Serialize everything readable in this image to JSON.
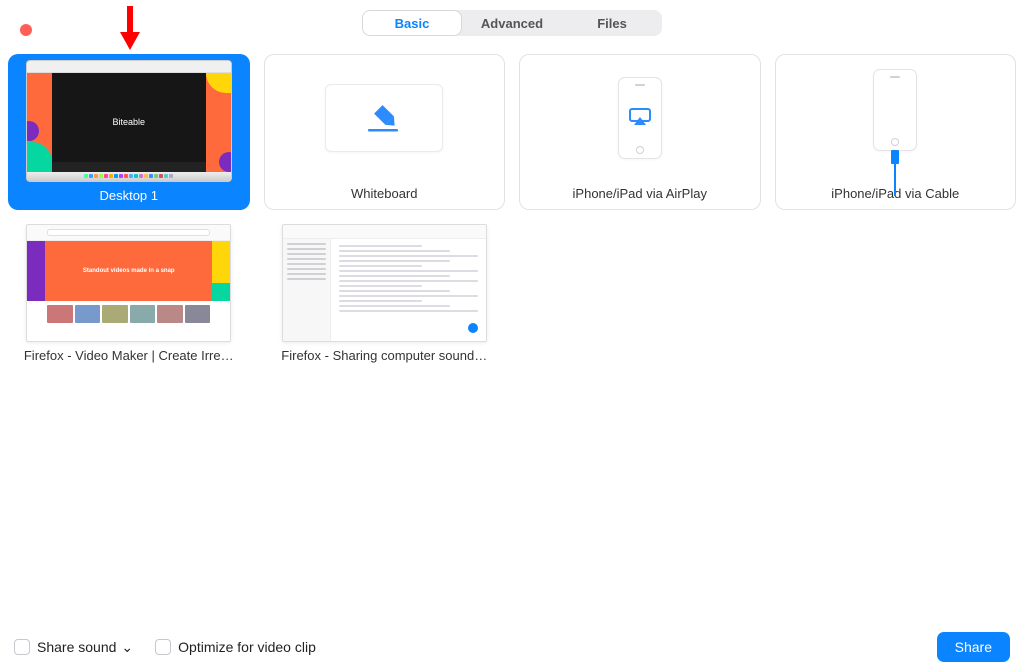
{
  "tabs": {
    "basic": "Basic",
    "advanced": "Advanced",
    "files": "Files"
  },
  "tiles": {
    "desktop1": {
      "label": "Desktop 1",
      "player_brand": "Biteable"
    },
    "whiteboard": {
      "label": "Whiteboard"
    },
    "airplay": {
      "label": "iPhone/iPad via AirPlay"
    },
    "cable": {
      "label": "iPhone/iPad via Cable"
    },
    "firefox1": {
      "label": "Firefox - Video Maker | Create Irre…",
      "hero_text": "Standout videos made in a snap"
    },
    "firefox2": {
      "label": "Firefox - Sharing computer sound…"
    }
  },
  "footer": {
    "share_sound": "Share sound",
    "optimize": "Optimize for video clip",
    "share_button": "Share"
  }
}
